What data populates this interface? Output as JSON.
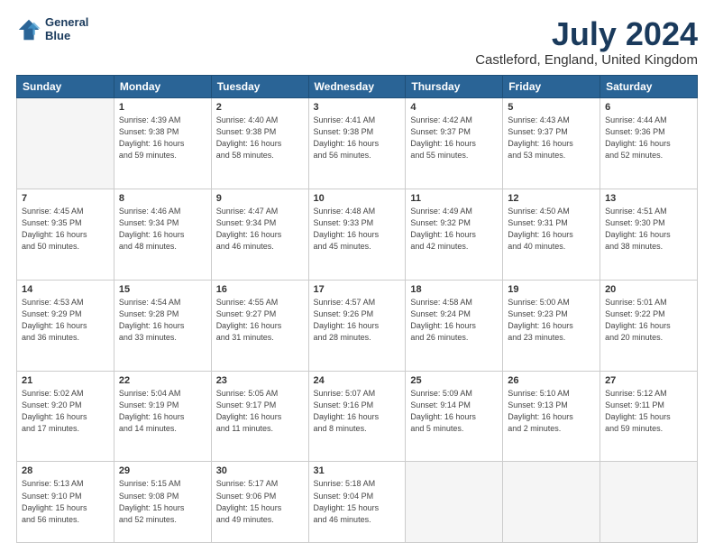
{
  "logo": {
    "line1": "General",
    "line2": "Blue"
  },
  "title": "July 2024",
  "subtitle": "Castleford, England, United Kingdom",
  "days_of_week": [
    "Sunday",
    "Monday",
    "Tuesday",
    "Wednesday",
    "Thursday",
    "Friday",
    "Saturday"
  ],
  "weeks": [
    [
      {
        "day": "",
        "info": ""
      },
      {
        "day": "1",
        "info": "Sunrise: 4:39 AM\nSunset: 9:38 PM\nDaylight: 16 hours\nand 59 minutes."
      },
      {
        "day": "2",
        "info": "Sunrise: 4:40 AM\nSunset: 9:38 PM\nDaylight: 16 hours\nand 58 minutes."
      },
      {
        "day": "3",
        "info": "Sunrise: 4:41 AM\nSunset: 9:38 PM\nDaylight: 16 hours\nand 56 minutes."
      },
      {
        "day": "4",
        "info": "Sunrise: 4:42 AM\nSunset: 9:37 PM\nDaylight: 16 hours\nand 55 minutes."
      },
      {
        "day": "5",
        "info": "Sunrise: 4:43 AM\nSunset: 9:37 PM\nDaylight: 16 hours\nand 53 minutes."
      },
      {
        "day": "6",
        "info": "Sunrise: 4:44 AM\nSunset: 9:36 PM\nDaylight: 16 hours\nand 52 minutes."
      }
    ],
    [
      {
        "day": "7",
        "info": "Sunrise: 4:45 AM\nSunset: 9:35 PM\nDaylight: 16 hours\nand 50 minutes."
      },
      {
        "day": "8",
        "info": "Sunrise: 4:46 AM\nSunset: 9:34 PM\nDaylight: 16 hours\nand 48 minutes."
      },
      {
        "day": "9",
        "info": "Sunrise: 4:47 AM\nSunset: 9:34 PM\nDaylight: 16 hours\nand 46 minutes."
      },
      {
        "day": "10",
        "info": "Sunrise: 4:48 AM\nSunset: 9:33 PM\nDaylight: 16 hours\nand 45 minutes."
      },
      {
        "day": "11",
        "info": "Sunrise: 4:49 AM\nSunset: 9:32 PM\nDaylight: 16 hours\nand 42 minutes."
      },
      {
        "day": "12",
        "info": "Sunrise: 4:50 AM\nSunset: 9:31 PM\nDaylight: 16 hours\nand 40 minutes."
      },
      {
        "day": "13",
        "info": "Sunrise: 4:51 AM\nSunset: 9:30 PM\nDaylight: 16 hours\nand 38 minutes."
      }
    ],
    [
      {
        "day": "14",
        "info": "Sunrise: 4:53 AM\nSunset: 9:29 PM\nDaylight: 16 hours\nand 36 minutes."
      },
      {
        "day": "15",
        "info": "Sunrise: 4:54 AM\nSunset: 9:28 PM\nDaylight: 16 hours\nand 33 minutes."
      },
      {
        "day": "16",
        "info": "Sunrise: 4:55 AM\nSunset: 9:27 PM\nDaylight: 16 hours\nand 31 minutes."
      },
      {
        "day": "17",
        "info": "Sunrise: 4:57 AM\nSunset: 9:26 PM\nDaylight: 16 hours\nand 28 minutes."
      },
      {
        "day": "18",
        "info": "Sunrise: 4:58 AM\nSunset: 9:24 PM\nDaylight: 16 hours\nand 26 minutes."
      },
      {
        "day": "19",
        "info": "Sunrise: 5:00 AM\nSunset: 9:23 PM\nDaylight: 16 hours\nand 23 minutes."
      },
      {
        "day": "20",
        "info": "Sunrise: 5:01 AM\nSunset: 9:22 PM\nDaylight: 16 hours\nand 20 minutes."
      }
    ],
    [
      {
        "day": "21",
        "info": "Sunrise: 5:02 AM\nSunset: 9:20 PM\nDaylight: 16 hours\nand 17 minutes."
      },
      {
        "day": "22",
        "info": "Sunrise: 5:04 AM\nSunset: 9:19 PM\nDaylight: 16 hours\nand 14 minutes."
      },
      {
        "day": "23",
        "info": "Sunrise: 5:05 AM\nSunset: 9:17 PM\nDaylight: 16 hours\nand 11 minutes."
      },
      {
        "day": "24",
        "info": "Sunrise: 5:07 AM\nSunset: 9:16 PM\nDaylight: 16 hours\nand 8 minutes."
      },
      {
        "day": "25",
        "info": "Sunrise: 5:09 AM\nSunset: 9:14 PM\nDaylight: 16 hours\nand 5 minutes."
      },
      {
        "day": "26",
        "info": "Sunrise: 5:10 AM\nSunset: 9:13 PM\nDaylight: 16 hours\nand 2 minutes."
      },
      {
        "day": "27",
        "info": "Sunrise: 5:12 AM\nSunset: 9:11 PM\nDaylight: 15 hours\nand 59 minutes."
      }
    ],
    [
      {
        "day": "28",
        "info": "Sunrise: 5:13 AM\nSunset: 9:10 PM\nDaylight: 15 hours\nand 56 minutes."
      },
      {
        "day": "29",
        "info": "Sunrise: 5:15 AM\nSunset: 9:08 PM\nDaylight: 15 hours\nand 52 minutes."
      },
      {
        "day": "30",
        "info": "Sunrise: 5:17 AM\nSunset: 9:06 PM\nDaylight: 15 hours\nand 49 minutes."
      },
      {
        "day": "31",
        "info": "Sunrise: 5:18 AM\nSunset: 9:04 PM\nDaylight: 15 hours\nand 46 minutes."
      },
      {
        "day": "",
        "info": ""
      },
      {
        "day": "",
        "info": ""
      },
      {
        "day": "",
        "info": ""
      }
    ]
  ]
}
